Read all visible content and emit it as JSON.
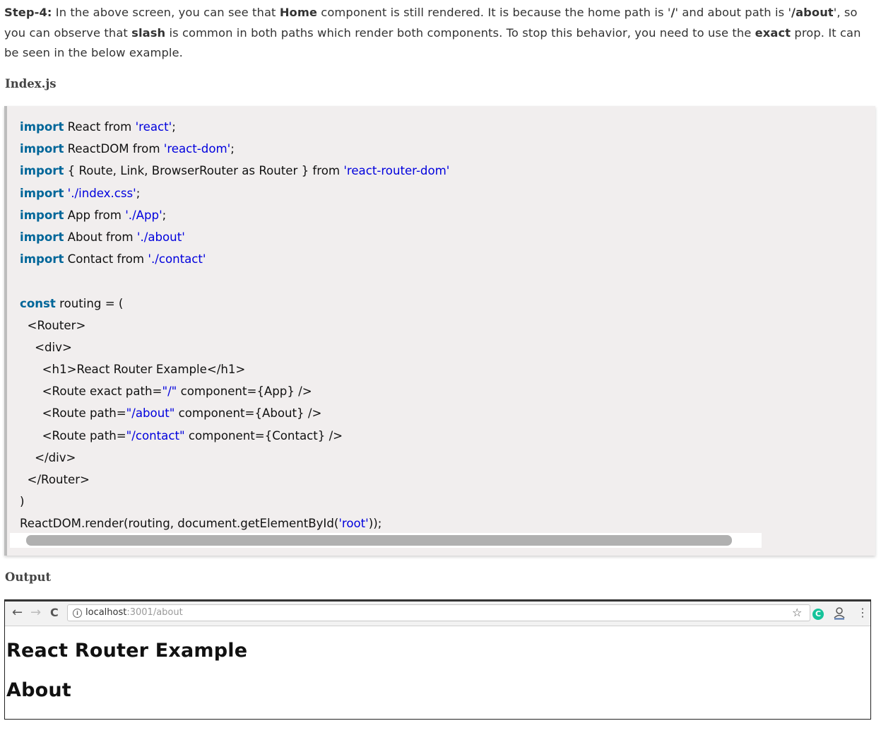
{
  "intro": {
    "segments": [
      {
        "text": "Step-4:",
        "bold": true
      },
      {
        "text": " In the above screen, you can see that ",
        "bold": false
      },
      {
        "text": "Home",
        "bold": true
      },
      {
        "text": " component is still rendered. It is because the home path is '",
        "bold": false
      },
      {
        "text": "/",
        "bold": true
      },
      {
        "text": "' and about path is '",
        "bold": false
      },
      {
        "text": "/about",
        "bold": true
      },
      {
        "text": "', so you can observe that ",
        "bold": false
      },
      {
        "text": "slash",
        "bold": true
      },
      {
        "text": " is common in both paths which render both components. To stop this behavior, you need to use the ",
        "bold": false
      },
      {
        "text": "exact",
        "bold": true
      },
      {
        "text": " prop. It can be seen in the below example.",
        "bold": false
      }
    ]
  },
  "file_heading": "Index.js",
  "code": {
    "lines": [
      [
        {
          "t": "import",
          "c": "kw"
        },
        {
          "t": " React from ",
          "c": ""
        },
        {
          "t": "'react'",
          "c": "str"
        },
        {
          "t": ";",
          "c": ""
        }
      ],
      [
        {
          "t": "import",
          "c": "kw"
        },
        {
          "t": " ReactDOM from ",
          "c": ""
        },
        {
          "t": "'react-dom'",
          "c": "str"
        },
        {
          "t": ";",
          "c": ""
        }
      ],
      [
        {
          "t": "import",
          "c": "kw"
        },
        {
          "t": " { Route, Link, BrowserRouter as Router } from ",
          "c": ""
        },
        {
          "t": "'react-router-dom'",
          "c": "str"
        }
      ],
      [
        {
          "t": "import",
          "c": "kw"
        },
        {
          "t": " ",
          "c": ""
        },
        {
          "t": "'./index.css'",
          "c": "str"
        },
        {
          "t": ";",
          "c": ""
        }
      ],
      [
        {
          "t": "import",
          "c": "kw"
        },
        {
          "t": " App from ",
          "c": ""
        },
        {
          "t": "'./App'",
          "c": "str"
        },
        {
          "t": ";",
          "c": ""
        }
      ],
      [
        {
          "t": "import",
          "c": "kw"
        },
        {
          "t": " About from ",
          "c": ""
        },
        {
          "t": "'./about'",
          "c": "str"
        }
      ],
      [
        {
          "t": "import",
          "c": "kw"
        },
        {
          "t": " Contact from ",
          "c": ""
        },
        {
          "t": "'./contact'",
          "c": "str"
        }
      ],
      [],
      [
        {
          "t": "const",
          "c": "kw"
        },
        {
          "t": " routing = (",
          "c": ""
        }
      ],
      [
        {
          "t": "  <Router>",
          "c": ""
        }
      ],
      [
        {
          "t": "    <div>",
          "c": ""
        }
      ],
      [
        {
          "t": "      <h1>React Router Example</h1>",
          "c": ""
        }
      ],
      [
        {
          "t": "      <Route exact path=",
          "c": ""
        },
        {
          "t": "\"/\"",
          "c": "str"
        },
        {
          "t": " component={App} />",
          "c": ""
        }
      ],
      [
        {
          "t": "      <Route path=",
          "c": ""
        },
        {
          "t": "\"/about\"",
          "c": "str"
        },
        {
          "t": " component={About} />",
          "c": ""
        }
      ],
      [
        {
          "t": "      <Route path=",
          "c": ""
        },
        {
          "t": "\"/contact\"",
          "c": "str"
        },
        {
          "t": " component={Contact} />",
          "c": ""
        }
      ],
      [
        {
          "t": "    </div>",
          "c": ""
        }
      ],
      [
        {
          "t": "  </Router>",
          "c": ""
        }
      ],
      [
        {
          "t": ")",
          "c": ""
        }
      ],
      [
        {
          "t": "ReactDOM.render(routing, document.getElementById(",
          "c": ""
        },
        {
          "t": "'root'",
          "c": "str"
        },
        {
          "t": "));",
          "c": ""
        }
      ]
    ]
  },
  "output_heading": "Output",
  "browser": {
    "back_icon": "←",
    "forward_icon": "→",
    "reload_icon": "C",
    "info_icon": "i",
    "url_host": "localhost",
    "url_path": ":3001/about",
    "star_icon": "☆",
    "extension_icon": "C",
    "menu_icon": "⋮",
    "page": {
      "h1": "React Router Example",
      "h2": "About"
    }
  }
}
